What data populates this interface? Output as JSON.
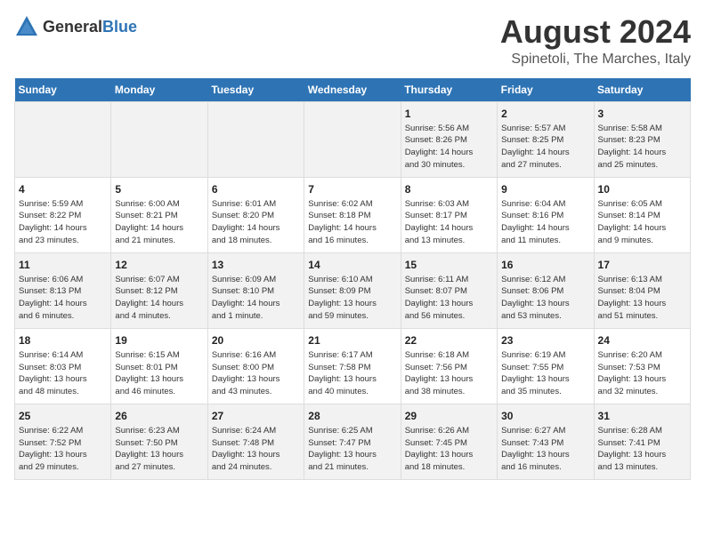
{
  "logo": {
    "general": "General",
    "blue": "Blue"
  },
  "header": {
    "title": "August 2024",
    "subtitle": "Spinetoli, The Marches, Italy"
  },
  "weekdays": [
    "Sunday",
    "Monday",
    "Tuesday",
    "Wednesday",
    "Thursday",
    "Friday",
    "Saturday"
  ],
  "weeks": [
    [
      {
        "day": "",
        "info": ""
      },
      {
        "day": "",
        "info": ""
      },
      {
        "day": "",
        "info": ""
      },
      {
        "day": "",
        "info": ""
      },
      {
        "day": "1",
        "info": "Sunrise: 5:56 AM\nSunset: 8:26 PM\nDaylight: 14 hours\nand 30 minutes."
      },
      {
        "day": "2",
        "info": "Sunrise: 5:57 AM\nSunset: 8:25 PM\nDaylight: 14 hours\nand 27 minutes."
      },
      {
        "day": "3",
        "info": "Sunrise: 5:58 AM\nSunset: 8:23 PM\nDaylight: 14 hours\nand 25 minutes."
      }
    ],
    [
      {
        "day": "4",
        "info": "Sunrise: 5:59 AM\nSunset: 8:22 PM\nDaylight: 14 hours\nand 23 minutes."
      },
      {
        "day": "5",
        "info": "Sunrise: 6:00 AM\nSunset: 8:21 PM\nDaylight: 14 hours\nand 21 minutes."
      },
      {
        "day": "6",
        "info": "Sunrise: 6:01 AM\nSunset: 8:20 PM\nDaylight: 14 hours\nand 18 minutes."
      },
      {
        "day": "7",
        "info": "Sunrise: 6:02 AM\nSunset: 8:18 PM\nDaylight: 14 hours\nand 16 minutes."
      },
      {
        "day": "8",
        "info": "Sunrise: 6:03 AM\nSunset: 8:17 PM\nDaylight: 14 hours\nand 13 minutes."
      },
      {
        "day": "9",
        "info": "Sunrise: 6:04 AM\nSunset: 8:16 PM\nDaylight: 14 hours\nand 11 minutes."
      },
      {
        "day": "10",
        "info": "Sunrise: 6:05 AM\nSunset: 8:14 PM\nDaylight: 14 hours\nand 9 minutes."
      }
    ],
    [
      {
        "day": "11",
        "info": "Sunrise: 6:06 AM\nSunset: 8:13 PM\nDaylight: 14 hours\nand 6 minutes."
      },
      {
        "day": "12",
        "info": "Sunrise: 6:07 AM\nSunset: 8:12 PM\nDaylight: 14 hours\nand 4 minutes."
      },
      {
        "day": "13",
        "info": "Sunrise: 6:09 AM\nSunset: 8:10 PM\nDaylight: 14 hours\nand 1 minute."
      },
      {
        "day": "14",
        "info": "Sunrise: 6:10 AM\nSunset: 8:09 PM\nDaylight: 13 hours\nand 59 minutes."
      },
      {
        "day": "15",
        "info": "Sunrise: 6:11 AM\nSunset: 8:07 PM\nDaylight: 13 hours\nand 56 minutes."
      },
      {
        "day": "16",
        "info": "Sunrise: 6:12 AM\nSunset: 8:06 PM\nDaylight: 13 hours\nand 53 minutes."
      },
      {
        "day": "17",
        "info": "Sunrise: 6:13 AM\nSunset: 8:04 PM\nDaylight: 13 hours\nand 51 minutes."
      }
    ],
    [
      {
        "day": "18",
        "info": "Sunrise: 6:14 AM\nSunset: 8:03 PM\nDaylight: 13 hours\nand 48 minutes."
      },
      {
        "day": "19",
        "info": "Sunrise: 6:15 AM\nSunset: 8:01 PM\nDaylight: 13 hours\nand 46 minutes."
      },
      {
        "day": "20",
        "info": "Sunrise: 6:16 AM\nSunset: 8:00 PM\nDaylight: 13 hours\nand 43 minutes."
      },
      {
        "day": "21",
        "info": "Sunrise: 6:17 AM\nSunset: 7:58 PM\nDaylight: 13 hours\nand 40 minutes."
      },
      {
        "day": "22",
        "info": "Sunrise: 6:18 AM\nSunset: 7:56 PM\nDaylight: 13 hours\nand 38 minutes."
      },
      {
        "day": "23",
        "info": "Sunrise: 6:19 AM\nSunset: 7:55 PM\nDaylight: 13 hours\nand 35 minutes."
      },
      {
        "day": "24",
        "info": "Sunrise: 6:20 AM\nSunset: 7:53 PM\nDaylight: 13 hours\nand 32 minutes."
      }
    ],
    [
      {
        "day": "25",
        "info": "Sunrise: 6:22 AM\nSunset: 7:52 PM\nDaylight: 13 hours\nand 29 minutes."
      },
      {
        "day": "26",
        "info": "Sunrise: 6:23 AM\nSunset: 7:50 PM\nDaylight: 13 hours\nand 27 minutes."
      },
      {
        "day": "27",
        "info": "Sunrise: 6:24 AM\nSunset: 7:48 PM\nDaylight: 13 hours\nand 24 minutes."
      },
      {
        "day": "28",
        "info": "Sunrise: 6:25 AM\nSunset: 7:47 PM\nDaylight: 13 hours\nand 21 minutes."
      },
      {
        "day": "29",
        "info": "Sunrise: 6:26 AM\nSunset: 7:45 PM\nDaylight: 13 hours\nand 18 minutes."
      },
      {
        "day": "30",
        "info": "Sunrise: 6:27 AM\nSunset: 7:43 PM\nDaylight: 13 hours\nand 16 minutes."
      },
      {
        "day": "31",
        "info": "Sunrise: 6:28 AM\nSunset: 7:41 PM\nDaylight: 13 hours\nand 13 minutes."
      }
    ]
  ]
}
